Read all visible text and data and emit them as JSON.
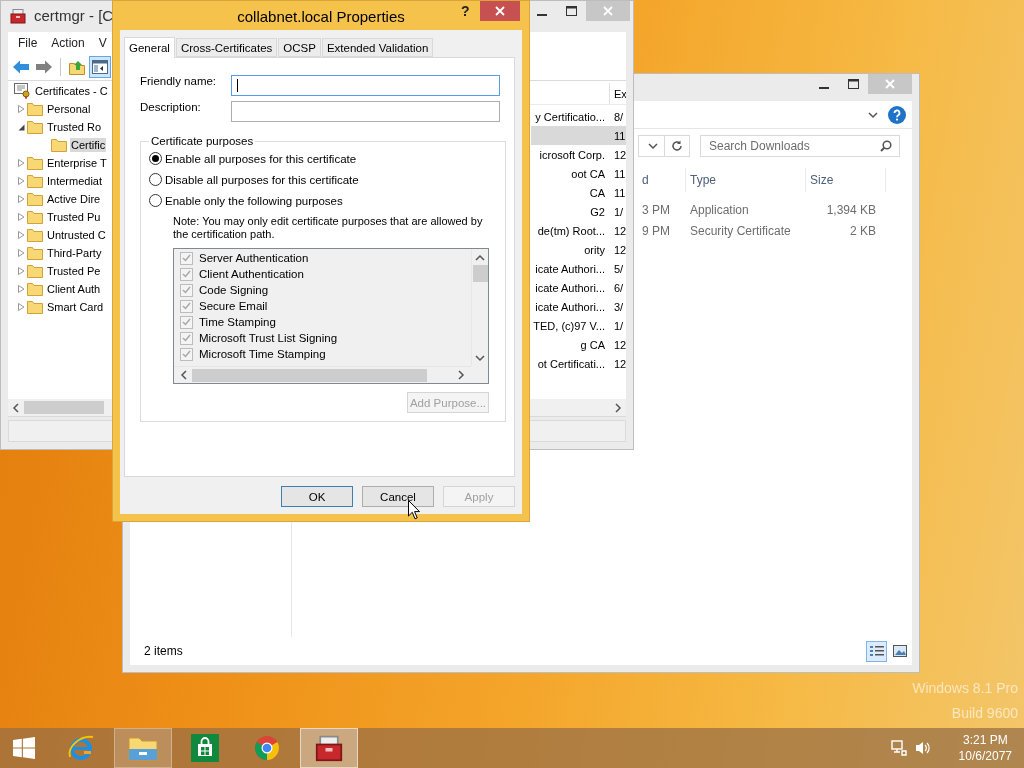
{
  "desktop": {
    "watermark": [
      "Windows 8.1 Pro",
      "Build 9600"
    ]
  },
  "explorer": {
    "search": {
      "placeholder": "Search Downloads"
    },
    "columns": [
      {
        "label": "d"
      },
      {
        "label": "Type"
      },
      {
        "label": "Size"
      }
    ],
    "rows": [
      {
        "cells": [
          "3 PM",
          "Application",
          "1,394 KB"
        ]
      },
      {
        "cells": [
          "9 PM",
          "Security Certificate",
          "2 KB"
        ]
      }
    ],
    "status": "2 items",
    "views": [
      {
        "kind": "details",
        "selected": true
      },
      {
        "kind": "thumbnails",
        "selected": false
      }
    ]
  },
  "certmgr": {
    "title": "certmgr - [C",
    "menu": [
      "File",
      "Action",
      "V"
    ],
    "toolbar": [
      {
        "kind": "back",
        "disabled": false,
        "selected": false
      },
      {
        "kind": "forward",
        "disabled": true,
        "selected": false
      },
      {
        "kind": "up",
        "disabled": false,
        "selected": false
      },
      {
        "kind": "tree",
        "disabled": false,
        "selected": true
      }
    ],
    "tree": [
      {
        "label": "Certificates - C",
        "selected": false,
        "children": [
          {
            "label": "Personal",
            "expanded": false,
            "selected": false
          },
          {
            "label": "Trusted Ro",
            "expanded": true,
            "selected": false,
            "children": [
              {
                "label": "Certific",
                "selected": true
              }
            ]
          },
          {
            "label": "Enterprise T",
            "expanded": false,
            "selected": false
          },
          {
            "label": "Intermediat",
            "expanded": false,
            "selected": false
          },
          {
            "label": "Active Dire",
            "expanded": false,
            "selected": false
          },
          {
            "label": "Trusted Pu",
            "expanded": false,
            "selected": false
          },
          {
            "label": "Untrusted C",
            "expanded": false,
            "selected": false
          },
          {
            "label": "Third-Party",
            "expanded": false,
            "selected": false
          },
          {
            "label": "Trusted Pe",
            "expanded": false,
            "selected": false
          },
          {
            "label": "Client Auth",
            "expanded": false,
            "selected": false
          },
          {
            "label": "Smart Card",
            "expanded": false,
            "selected": false
          }
        ]
      }
    ],
    "list": {
      "header": "Ex",
      "rows": [
        {
          "column_1": "y Certificatio...",
          "column_2": "8/",
          "selected": false
        },
        {
          "column_2": "11",
          "selected": true
        },
        {
          "column_1": "icrosoft Corp.",
          "column_2": "12",
          "selected": false
        },
        {
          "column_1": "oot CA",
          "column_2": "11",
          "selected": false
        },
        {
          "column_1": "CA",
          "column_2": "11",
          "selected": false
        },
        {
          "column_1": "G2",
          "column_2": "1/",
          "selected": false
        },
        {
          "column_1": "de(tm) Root...",
          "column_2": "12",
          "selected": false
        },
        {
          "column_1": "ority",
          "column_2": "12",
          "selected": false
        },
        {
          "column_1": "icate Authori...",
          "column_2": "5/",
          "selected": false
        },
        {
          "column_1": "icate Authori...",
          "column_2": "6/",
          "selected": false
        },
        {
          "column_1": "icate Authori...",
          "column_2": "3/",
          "selected": false
        },
        {
          "column_1": "TED, (c)97 V...",
          "column_2": "1/",
          "selected": false
        },
        {
          "column_1": "g CA",
          "column_2": "12",
          "selected": false
        },
        {
          "column_1": "ot Certificati...",
          "column_2": "12",
          "selected": false
        }
      ]
    }
  },
  "dialog": {
    "title": "collabnet.local Properties",
    "help": "?",
    "tabs": [
      {
        "label": "General",
        "selected": true
      },
      {
        "label": "Cross-Certificates",
        "selected": false
      },
      {
        "label": "OCSP",
        "selected": false
      },
      {
        "label": "Extended Validation",
        "selected": false
      }
    ],
    "fields": [
      {
        "label": "Friendly name:",
        "focused": true
      },
      {
        "label": "Description:",
        "focused": false
      }
    ],
    "group": "Certificate purposes",
    "radios": [
      {
        "label": "Enable all purposes for this certificate",
        "selected": true
      },
      {
        "label": "Disable all purposes for this certificate",
        "selected": false
      },
      {
        "label": "Enable only the following purposes",
        "selected": false
      }
    ],
    "note": "Note: You may only edit certificate purposes that are allowed by the certification path.",
    "purposes": {
      "disabled": true,
      "items": [
        {
          "label": "Server Authentication",
          "checked": true
        },
        {
          "label": "Client Authentication",
          "checked": true
        },
        {
          "label": "Code Signing",
          "checked": true
        },
        {
          "label": "Secure Email",
          "checked": true
        },
        {
          "label": "Time Stamping",
          "checked": true
        },
        {
          "label": "Microsoft Trust List Signing",
          "checked": true
        },
        {
          "label": "Microsoft Time Stamping",
          "checked": true
        }
      ]
    },
    "add_purpose": {
      "label": "Add Purpose...",
      "disabled": true
    },
    "buttons": [
      {
        "label": "OK",
        "default": true,
        "disabled": false
      },
      {
        "label": "Cancel",
        "default": false,
        "disabled": false
      },
      {
        "label": "Apply",
        "default": false,
        "disabled": true
      }
    ]
  },
  "taskbar": {
    "apps": [
      {
        "kind": "start",
        "running": false,
        "active": false
      },
      {
        "kind": "ie",
        "running": false,
        "active": false
      },
      {
        "kind": "files",
        "running": true,
        "active": false
      },
      {
        "kind": "store",
        "running": false,
        "active": false
      },
      {
        "kind": "chrome",
        "running": false,
        "active": false
      },
      {
        "kind": "toolbox",
        "running": true,
        "active": true
      }
    ],
    "time": "3:21 PM",
    "date": "10/6/2077"
  }
}
